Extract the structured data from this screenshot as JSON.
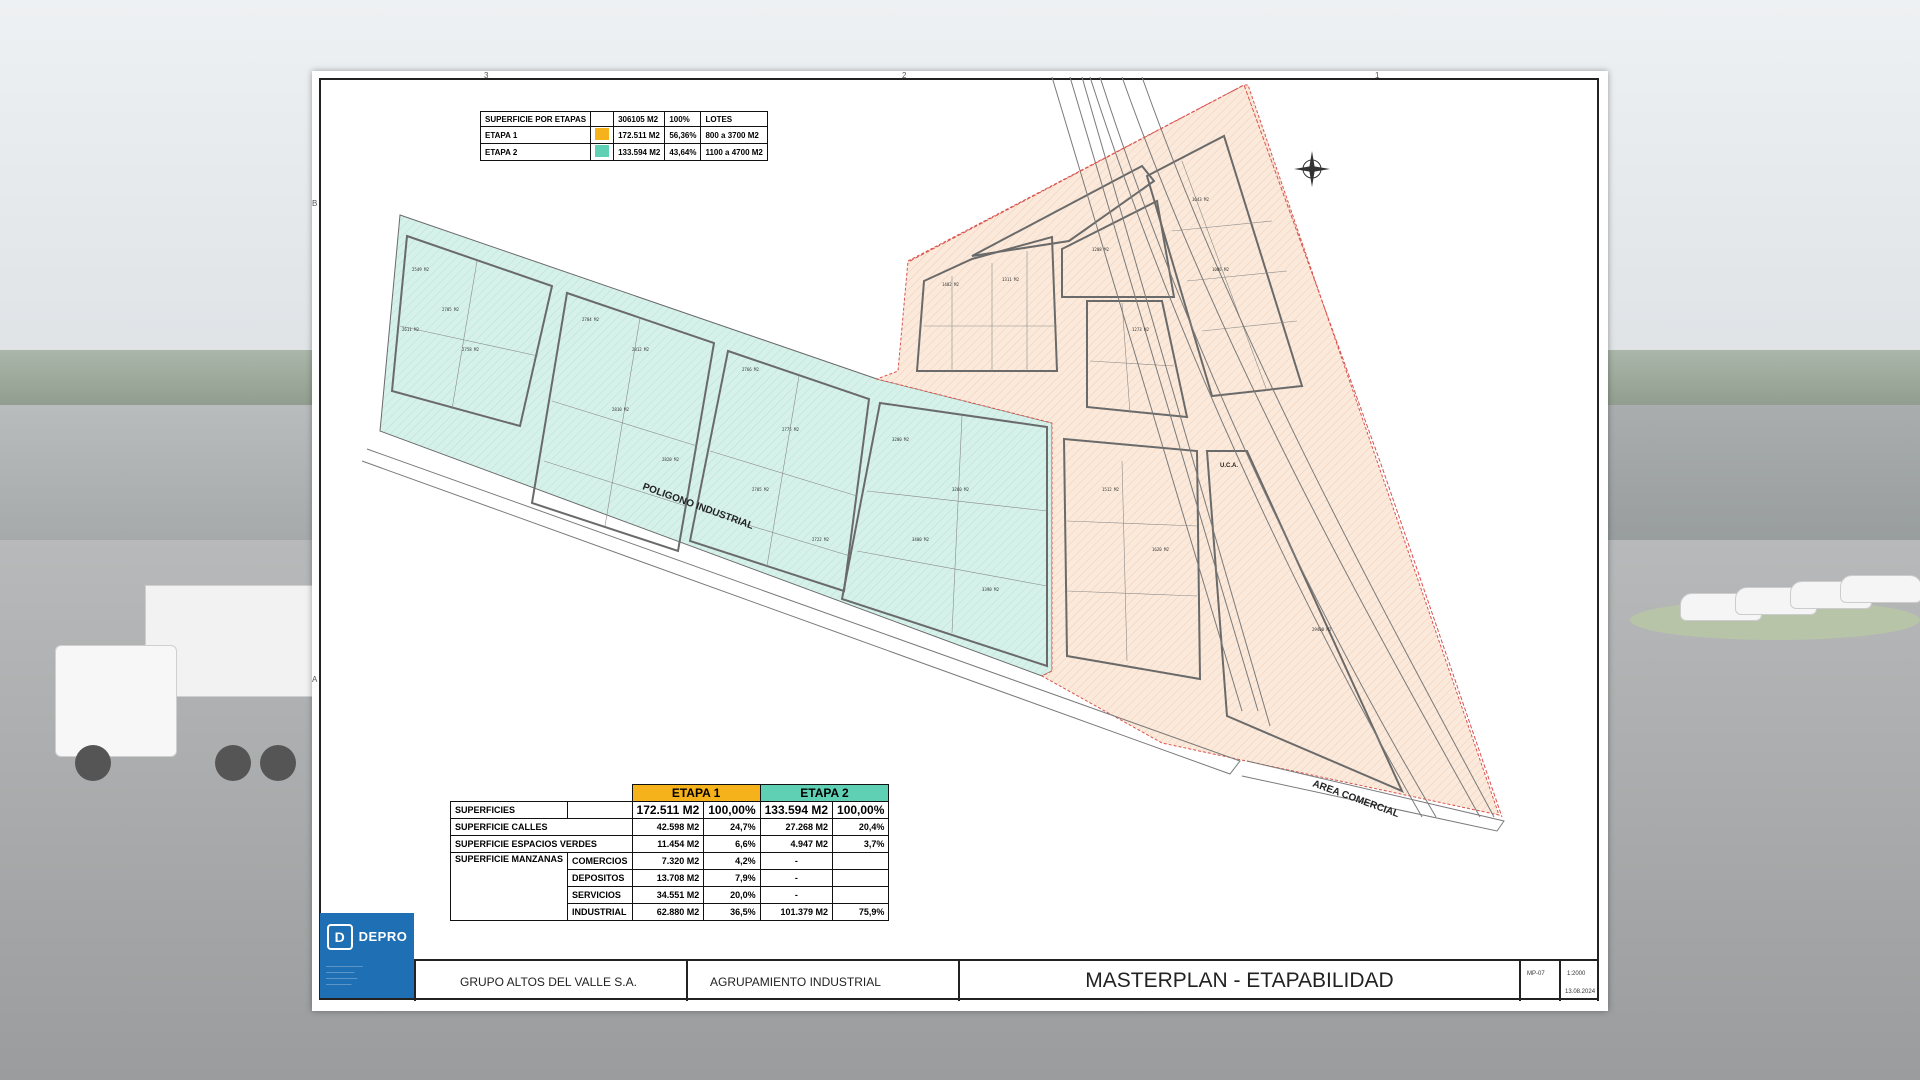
{
  "sheet": {
    "frame_refs": [
      "3",
      "2",
      "1",
      "B",
      "A"
    ],
    "north_arrow": "north-arrow-icon"
  },
  "stage_table": {
    "header": [
      "SUPERFICIE POR ETAPAS",
      "",
      "306105 M2",
      "100%",
      "LOTES"
    ],
    "rows": [
      {
        "label": "ETAPA 1",
        "color": "#f5b21b",
        "area": "172.511 M2",
        "pct": "56,36%",
        "lots": "800 a 3700 M2"
      },
      {
        "label": "ETAPA 2",
        "color": "#5fd0b4",
        "area": "133.594 M2",
        "pct": "43,64%",
        "lots": "1100 a 4700 M2"
      }
    ]
  },
  "summary_table": {
    "stage1": {
      "title": "ETAPA 1",
      "color": "#f5b21b",
      "area": "172.511 M2",
      "pct": "100,00%"
    },
    "stage2": {
      "title": "ETAPA 2",
      "color": "#5fd0b4",
      "area": "133.594 M2",
      "pct": "100,00%"
    },
    "superficies_label": "SUPERFICIES",
    "calles": {
      "label": "SUPERFICIE CALLES",
      "e1": "42.598 M2",
      "e1p": "24,7%",
      "e2": "27.268 M2",
      "e2p": "20,4%"
    },
    "verdes": {
      "label": "SUPERFICIE ESPACIOS VERDES",
      "e1": "11.454 M2",
      "e1p": "6,6%",
      "e2": "4.947 M2",
      "e2p": "3,7%"
    },
    "manzanas_label": "SUPERFICIE MANZANAS",
    "manzanas": [
      {
        "label": "COMERCIOS",
        "e1": "7.320 M2",
        "e1p": "4,2%",
        "e2": "-",
        "e2p": ""
      },
      {
        "label": "DEPOSITOS",
        "e1": "13.708 M2",
        "e1p": "7,9%",
        "e2": "-",
        "e2p": ""
      },
      {
        "label": "SERVICIOS",
        "e1": "34.551 M2",
        "e1p": "20,0%",
        "e2": "-",
        "e2p": ""
      },
      {
        "label": "INDUSTRIAL",
        "e1": "62.880 M2",
        "e1p": "36,5%",
        "e2": "101.379 M2",
        "e2p": "75,9%"
      }
    ]
  },
  "map": {
    "road_industrial": "POLIGONO INDUSTRIAL",
    "road_comercial": "AREA COMERCIAL",
    "uca": "U.C.A.",
    "colors": {
      "stage1_fill": "#fbeadb",
      "stage2_fill": "#d6f1ea",
      "lines": "#6a6a6a",
      "red": "#d9534f"
    }
  },
  "logo": {
    "name": "DEPRO",
    "icon": "depro-logo-icon"
  },
  "title_block": {
    "client": "GRUPO ALTOS DEL VALLE S.A.",
    "project": "AGRUPAMIENTO INDUSTRIAL",
    "content": "MASTERPLAN - ETAPABILIDAD",
    "plan_code": "MP-07",
    "scale": "1:2000",
    "date": "13.08.2024"
  }
}
